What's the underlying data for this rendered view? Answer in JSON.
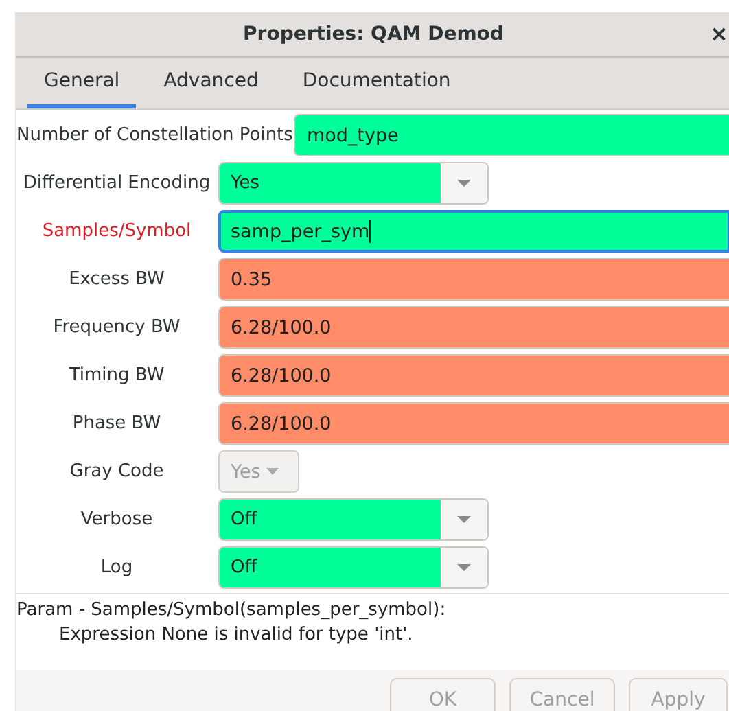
{
  "window": {
    "title": "Properties: QAM Demod",
    "close": "×"
  },
  "tabs": [
    {
      "label": "General",
      "selected": true
    },
    {
      "label": "Advanced",
      "selected": false
    },
    {
      "label": "Documentation",
      "selected": false
    }
  ],
  "params": [
    {
      "label": "Number of Constellation Points",
      "kind": "entry",
      "value": "mod_type",
      "color": "#00ff99",
      "error": false,
      "focused": false,
      "disabled": false
    },
    {
      "label": "Differential Encoding",
      "kind": "enum",
      "value": "Yes",
      "color": "#00ff99",
      "error": false,
      "focused": false,
      "disabled": false
    },
    {
      "label": "Samples/Symbol",
      "kind": "entry",
      "value": "samp_per_sym",
      "color": "#00ff99",
      "error": true,
      "focused": true,
      "disabled": false
    },
    {
      "label": "Excess BW",
      "kind": "entry",
      "value": "0.35",
      "color": "#ff8c69",
      "error": false,
      "focused": false,
      "disabled": false
    },
    {
      "label": "Frequency BW",
      "kind": "entry",
      "value": "6.28/100.0",
      "color": "#ff8c69",
      "error": false,
      "focused": false,
      "disabled": false
    },
    {
      "label": "Timing BW",
      "kind": "entry",
      "value": "6.28/100.0",
      "color": "#ff8c69",
      "error": false,
      "focused": false,
      "disabled": false
    },
    {
      "label": "Phase BW",
      "kind": "entry",
      "value": "6.28/100.0",
      "color": "#ff8c69",
      "error": false,
      "focused": false,
      "disabled": false
    },
    {
      "label": "Gray Code",
      "kind": "enum",
      "value": "Yes",
      "color": "#f2f1f0",
      "error": false,
      "focused": false,
      "disabled": true
    },
    {
      "label": "Verbose",
      "kind": "enum",
      "value": "Off",
      "color": "#00ff99",
      "error": false,
      "focused": false,
      "disabled": false
    },
    {
      "label": "Log",
      "kind": "enum",
      "value": "Off",
      "color": "#00ff99",
      "error": false,
      "focused": false,
      "disabled": false
    }
  ],
  "message": [
    "Param - Samples/Symbol(samples_per_symbol):",
    "Expression None is invalid for type 'int'."
  ],
  "buttons": [
    "OK",
    "Cancel",
    "Apply"
  ]
}
